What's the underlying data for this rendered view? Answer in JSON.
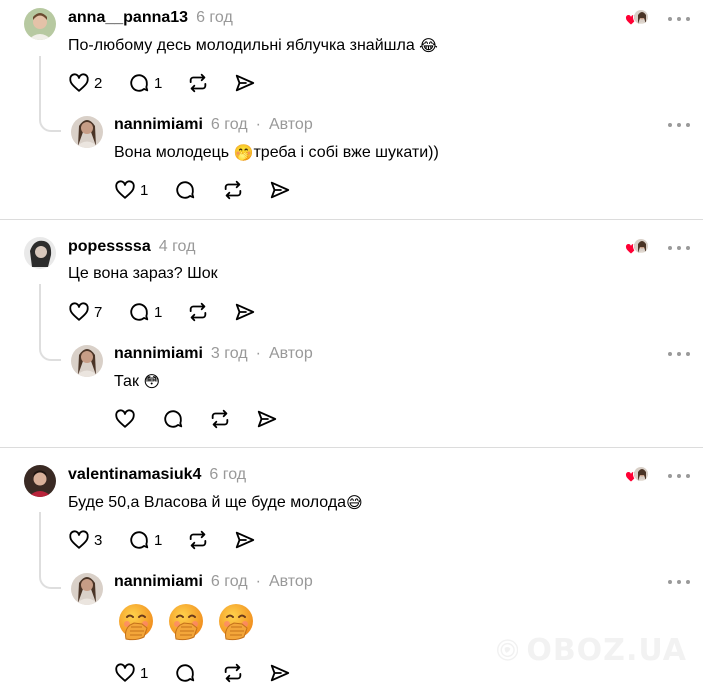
{
  "threads": [
    {
      "comment": {
        "username": "anna__panna13",
        "time": "6 год",
        "text": "По-любому десь молодильні яблучка знайшла",
        "emoji": "😂",
        "likes": "2",
        "replies": "1"
      },
      "reply": {
        "username": "nannimiami",
        "time": "6 год",
        "separator": "·",
        "author_label": "Автор",
        "text_before": "Вона молодець",
        "emoji": "🤭",
        "text_after": "треба і собі вже шукати))",
        "likes": "1"
      }
    },
    {
      "comment": {
        "username": "popessssa",
        "time": "4 год",
        "text": "Це вона зараз? Шок",
        "likes": "7",
        "replies": "1"
      },
      "reply": {
        "username": "nannimiami",
        "time": "3 год",
        "separator": "·",
        "author_label": "Автор",
        "text_before": "Так",
        "emoji": "😳",
        "likes": ""
      }
    },
    {
      "comment": {
        "username": "valentinamasiuk4",
        "time": "6 год",
        "text": "Буде 50,а Власова й ще буде молода",
        "emoji": "😅",
        "likes": "3",
        "replies": "1"
      },
      "reply": {
        "username": "nannimiami",
        "time": "6 год",
        "separator": "·",
        "author_label": "Автор",
        "big_emojis": [
          "🤭",
          "🤭",
          "🤭"
        ],
        "likes": "1"
      }
    }
  ],
  "watermark": {
    "text": "OBOZ.UA"
  },
  "colors": {
    "muted": "#999999",
    "divider": "#dcdcdc",
    "heart": "#ff0034"
  }
}
